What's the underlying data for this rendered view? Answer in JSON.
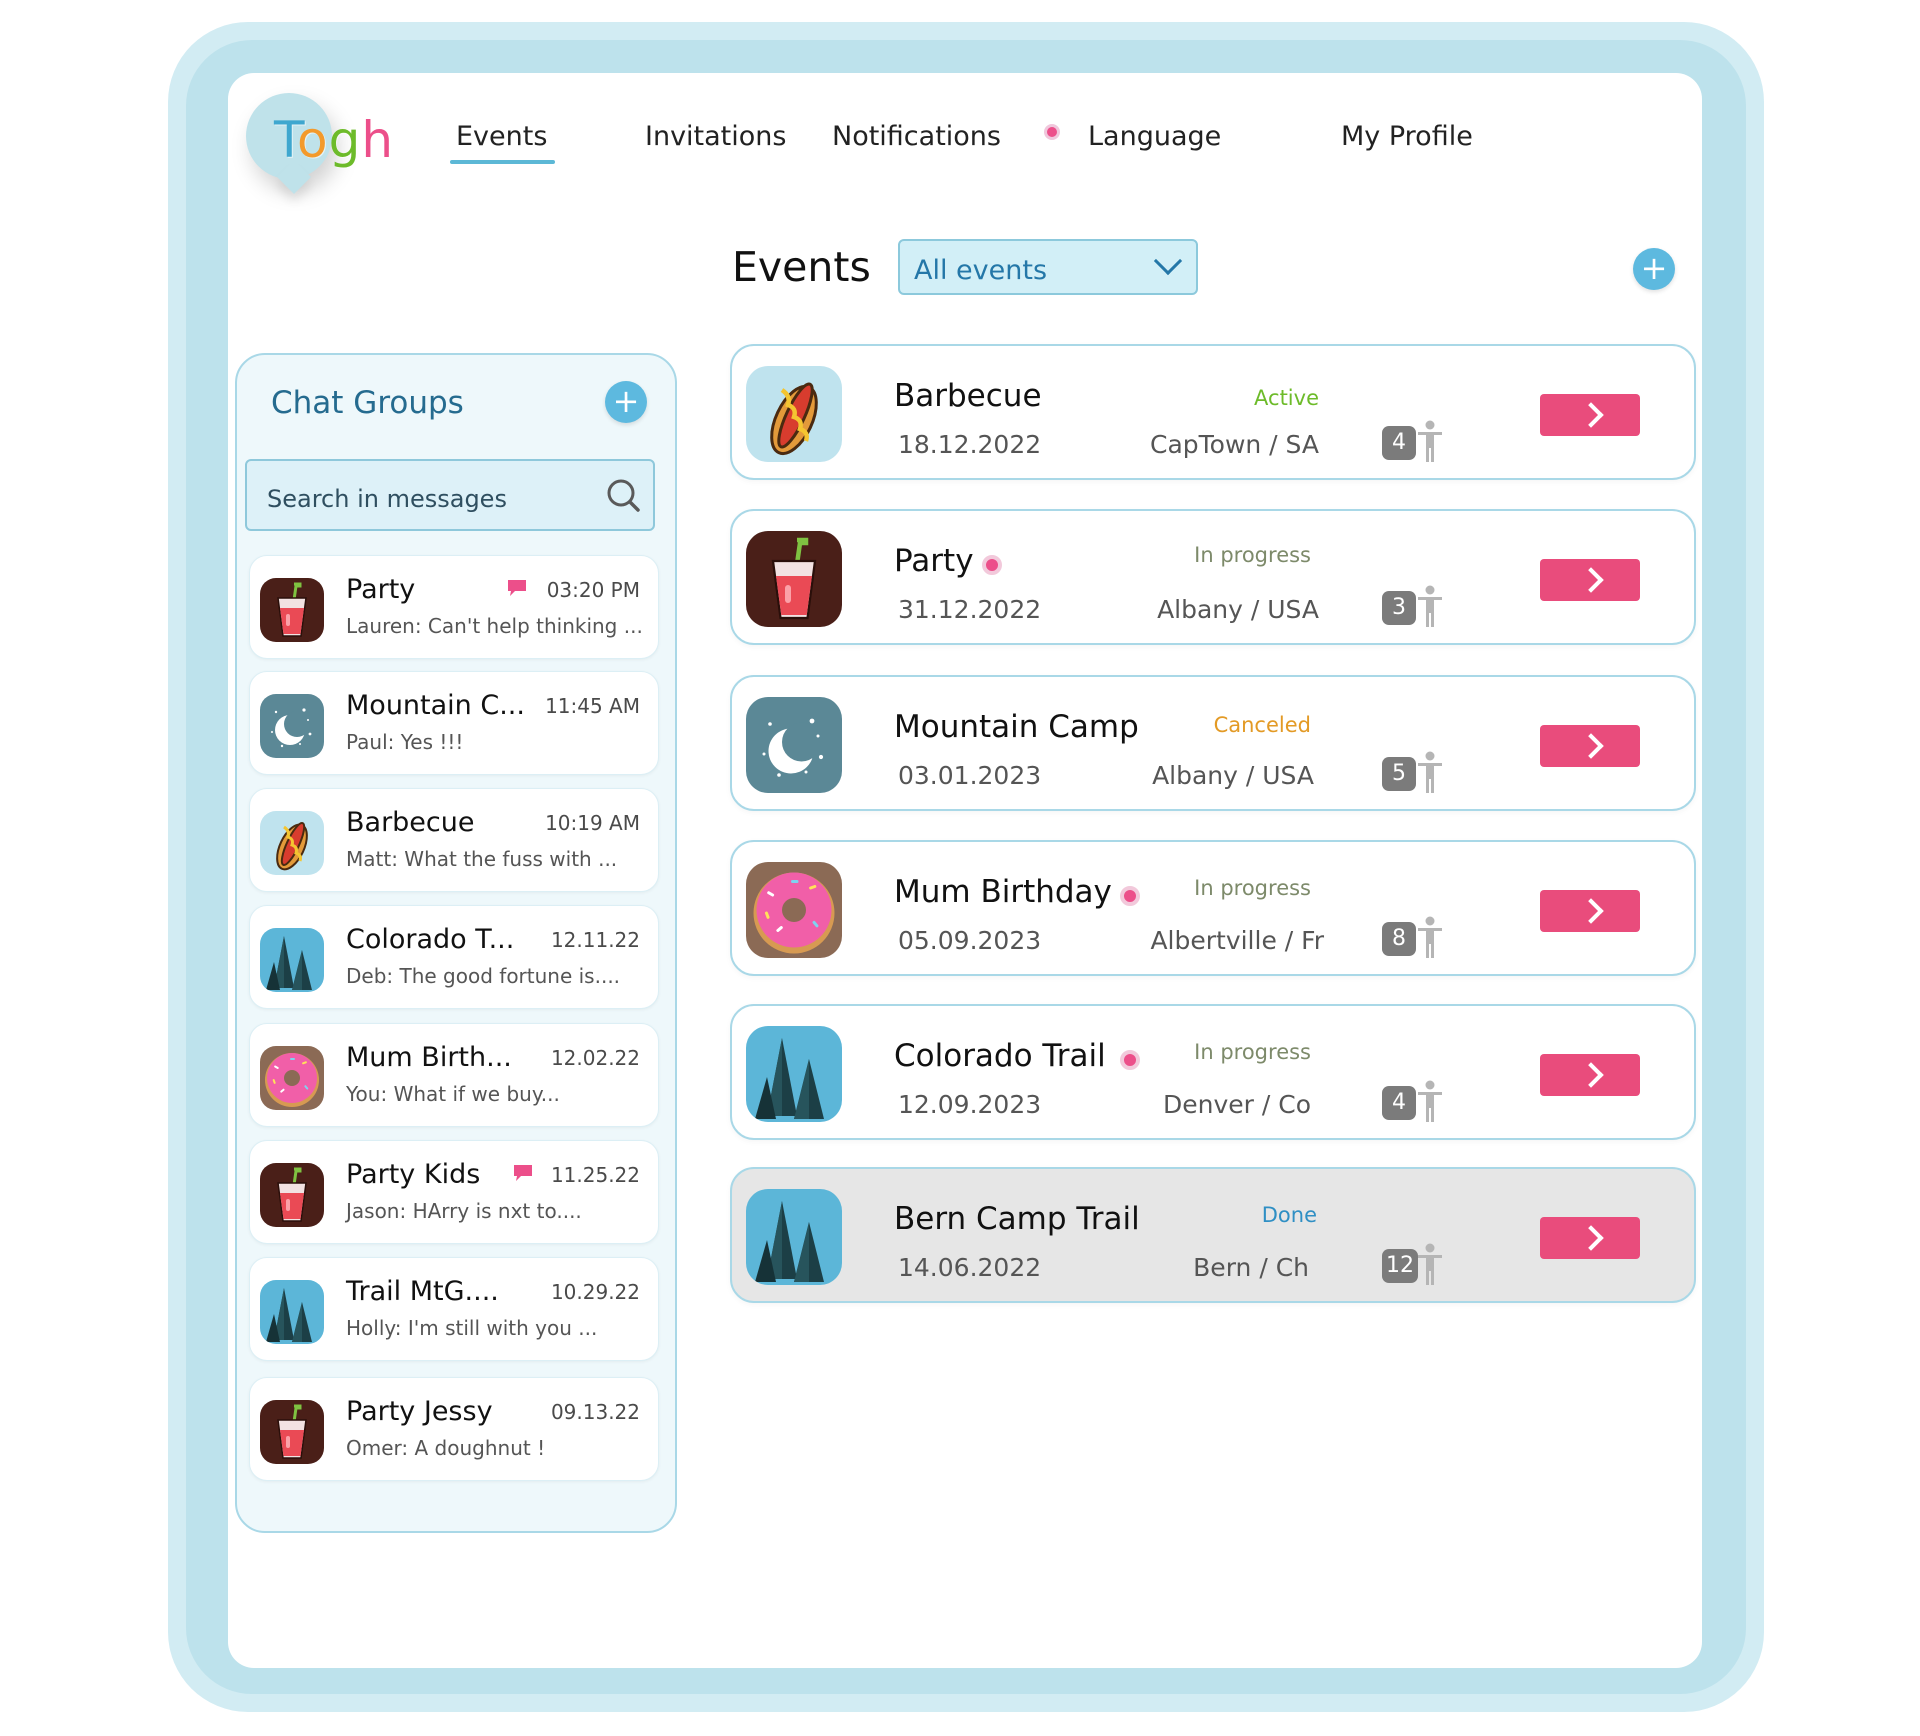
{
  "logo": {
    "letters": [
      "T",
      "o",
      "g",
      "h"
    ]
  },
  "nav": {
    "events": "Events",
    "invitations": "Invitations",
    "notifications": "Notifications",
    "language": "Language",
    "profile": "My Profile"
  },
  "events_header": {
    "title": "Events",
    "filter_value": "All events"
  },
  "chat": {
    "title": "Chat Groups",
    "search_placeholder": "Search in messages",
    "items": [
      {
        "name": "Party",
        "time": "03:20 PM",
        "preview": "Lauren: Can't help thinking ...",
        "icon": "drink-icon",
        "unread": true
      },
      {
        "name": "Mountain C...",
        "time": "11:45 AM",
        "preview": "Paul:  Yes !!!",
        "icon": "moon-icon",
        "unread": false
      },
      {
        "name": "Barbecue",
        "time": "10:19 AM",
        "preview": "Matt: What the fuss with ...",
        "icon": "hotdog-icon",
        "unread": false
      },
      {
        "name": "Colorado T...",
        "time": "12.11.22",
        "preview": "Deb: The good fortune is....",
        "icon": "trees-icon",
        "unread": false
      },
      {
        "name": "Mum Birth...",
        "time": "12.02.22",
        "preview": "You: What if we buy...",
        "icon": "donut-icon",
        "unread": false
      },
      {
        "name": "Party Kids",
        "time": "11.25.22",
        "preview": "Jason: HArry is nxt to....",
        "icon": "drink-icon",
        "unread": true
      },
      {
        "name": "Trail MtG....",
        "time": "10.29.22",
        "preview": "Holly: I'm still with you ...",
        "icon": "trees-icon",
        "unread": false
      },
      {
        "name": "Party Jessy",
        "time": "09.13.22",
        "preview": "Omer: A doughnut !",
        "icon": "drink-icon",
        "unread": false
      }
    ]
  },
  "events": [
    {
      "name": "Barbecue",
      "date": "18.12.2022",
      "status": "Active",
      "status_color": "#6dbb2a",
      "location": "CapTown / SA",
      "count": "4",
      "icon": "hotdog-icon",
      "notify": false,
      "done": false
    },
    {
      "name": "Party",
      "date": "31.12.2022",
      "status": "In progress",
      "status_color": "#7d8a6a",
      "location": "Albany / USA",
      "count": "3",
      "icon": "drink-icon",
      "notify": true,
      "done": false
    },
    {
      "name": "Mountain Camp",
      "date": "03.01.2023",
      "status": "Canceled",
      "status_color": "#e39a25",
      "location": "Albany / USA",
      "count": "5",
      "icon": "moon-icon",
      "notify": false,
      "done": false
    },
    {
      "name": "Mum Birthday",
      "date": "05.09.2023",
      "status": "In progress",
      "status_color": "#7d8a6a",
      "location": "Albertville / Fr",
      "count": "8",
      "icon": "donut-icon",
      "notify": true,
      "done": false
    },
    {
      "name": "Colorado Trail",
      "date": "12.09.2023",
      "status": "In progress",
      "status_color": "#7d8a6a",
      "location": "Denver / Co",
      "count": "4",
      "icon": "trees-icon",
      "notify": true,
      "done": false
    },
    {
      "name": "Bern Camp Trail",
      "date": "14.06.2022",
      "status": "Done",
      "status_color": "#2f8fc4",
      "location": "Bern / Ch",
      "count": "12",
      "icon": "trees-icon",
      "notify": false,
      "done": true
    }
  ],
  "colors": {
    "accent": "#5db9df",
    "action": "#e94c7c",
    "notification_dot": "#ec4f8a"
  }
}
